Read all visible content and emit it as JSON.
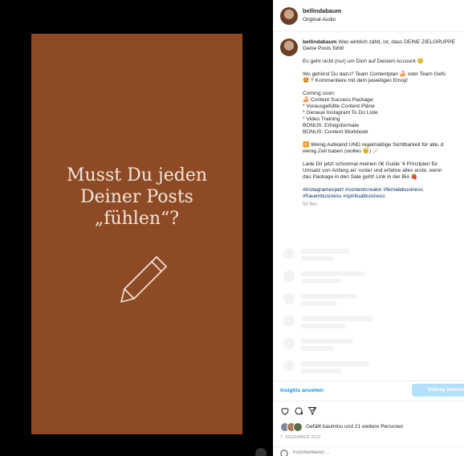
{
  "reel": {
    "headline": [
      "Musst Du jeden",
      "Deiner Posts",
      "„fühlen“?"
    ],
    "background_color": "#8e4a24",
    "icon": "pencil-icon"
  },
  "header": {
    "username": "bellindabaum",
    "audio_label": "Original-Audio"
  },
  "caption": {
    "username": "bellindabaum",
    "paragraphs": [
      [
        "Was wirklich zählt, ist, dass DEINE ZIELGRUPPE",
        "Deine Posts fühlt!"
      ],
      [
        "Es geht nicht (nur) um Dich auf Deinem Account 😊"
      ],
      [
        "Wo gehörst Du dazu? Team Contentplan 🍰 oder Team Gefü",
        "🤩 ? Kommentiere mit dem jeweiligen Emoji!"
      ],
      [
        "Coming soon:",
        "🍰 Content Success Package:",
        "* Vorausgefüllte Content Pläne",
        "* Genaue Instagram To Do Liste",
        "* Video Training",
        "BONUS: Erfolgsformate",
        "BONUS: Content Workbook"
      ],
      [
        "▶️ Wenig Aufwand UND regelmäßige Sichtbarkeit für alle, d",
        "wenig Zeit haben (wollen 😉) 🪄"
      ],
      [
        "Lade Dir jetzt schonmal meinen 0€ Guide '4 Prinzipien für",
        "Umsatz von Anfang an' runter und erfahre alles erste, wenn",
        "das Package in den Sale geht! Link in der Bio 🍓"
      ]
    ],
    "hashtags": [
      "#instagramexpert #contentcreator #femalebusiness",
      "#frauenbusiness #spiritualbusiness"
    ],
    "time": "50 Wo."
  },
  "footer": {
    "insights_label": "Insights ansehen",
    "boost_label": "Beitrag bewerben",
    "likes_text": "Gefällt baumlou und 21 weitere Personen",
    "date": "7. DEZEMBER 2022",
    "comment_placeholder": "Kommentieren ..."
  },
  "colors": {
    "accent": "#0095f6",
    "link": "#00376b",
    "boost_button": "#b2dffc"
  }
}
